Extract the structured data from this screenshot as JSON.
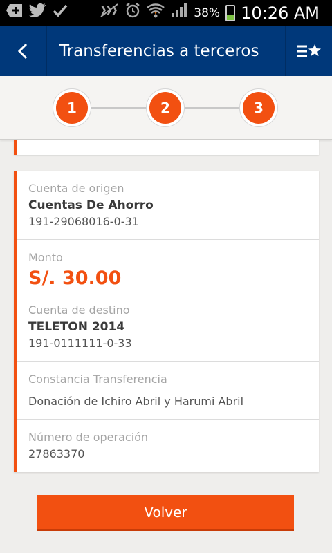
{
  "status_bar": {
    "battery_percent": "38%",
    "battery_level": 0.38,
    "time": "10:26 AM"
  },
  "header": {
    "title": "Transferencias a terceros",
    "back_icon": "chevron-left-icon",
    "favorite_icon": "list-star-icon"
  },
  "stepper": {
    "steps": [
      "1",
      "2",
      "3"
    ]
  },
  "details": {
    "origin": {
      "label": "Cuenta de origen",
      "name": "Cuentas De Ahorro",
      "number": "191-29068016-0-31"
    },
    "amount": {
      "label": "Monto",
      "value": "S/. 30.00"
    },
    "destination": {
      "label": "Cuenta de destino",
      "name": "TELETON 2014",
      "number": "191-0111111-0-33"
    },
    "note": {
      "label": "Constancia Transferencia",
      "value": "Donación de Ichiro Abril y Harumi Abril"
    },
    "operation": {
      "label": "Número de operación",
      "value": "27863370"
    }
  },
  "actions": {
    "back_label": "Volver"
  },
  "colors": {
    "header": "#00387a",
    "accent": "#f25011",
    "background": "#efeeec"
  }
}
